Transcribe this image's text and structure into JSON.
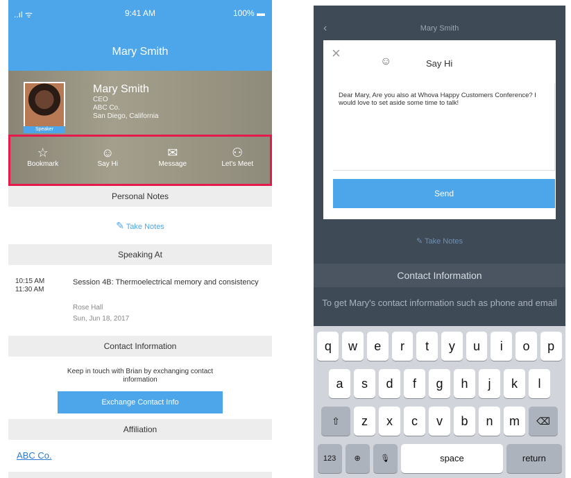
{
  "left": {
    "status": {
      "signal": "..ıl ᯤ",
      "time": "9:41 AM",
      "battery": "100% ▬"
    },
    "nav_title": "Mary Smith",
    "profile": {
      "name": "Mary Smith",
      "lines": [
        "CEO",
        "ABC Co.",
        "San Diego, California"
      ],
      "badge": "Speaker"
    },
    "actions": [
      {
        "icon": "☆",
        "label": "Bookmark",
        "name": "bookmark"
      },
      {
        "icon": "☺",
        "label": "Say Hi",
        "name": "say-hi"
      },
      {
        "icon": "✉",
        "label": "Message",
        "name": "message"
      },
      {
        "icon": "⚇",
        "label": "Let's Meet",
        "name": "lets-meet"
      }
    ],
    "personal_notes": {
      "title": "Personal Notes",
      "link": "Take Notes",
      "pencil": "✎"
    },
    "speaking": {
      "title": "Speaking At",
      "start": "10:15 AM",
      "end": "11:30 AM",
      "session": "Session 4B: Thermoelectrical memory and consistency",
      "room": "Rose Hall",
      "date": "Sun, Jun 18, 2017"
    },
    "contact": {
      "title": "Contact Information",
      "text": "Keep in touch with Brian by exchanging contact information",
      "button": "Exchange Contact Info"
    },
    "affiliation": {
      "title": "Affiliation",
      "link": "ABC Co."
    }
  },
  "right": {
    "nav_title": "Mary Smith",
    "back": "‹",
    "modal": {
      "close": "×",
      "face_icon": "☺",
      "title": "Say Hi",
      "message": "Dear Mary, Are you also at Whova Happy Customers Conference? I would love to set aside some time to talk!",
      "send": "Send"
    },
    "bg_notes": "✎ Take Notes",
    "bg_contact_title": "Contact Information",
    "bg_contact_text": "To get Mary's contact information such as phone and email",
    "keyboard": {
      "row1": [
        "q",
        "w",
        "e",
        "r",
        "t",
        "y",
        "u",
        "i",
        "o",
        "p"
      ],
      "row2": [
        "a",
        "s",
        "d",
        "f",
        "g",
        "h",
        "j",
        "k",
        "l"
      ],
      "row3": [
        "z",
        "x",
        "c",
        "v",
        "b",
        "n",
        "m"
      ],
      "shift": "⇧",
      "delete": "⌫",
      "numbers": "123",
      "globe": "⊕",
      "mic": "🎙",
      "space": "space",
      "return": "return"
    }
  }
}
